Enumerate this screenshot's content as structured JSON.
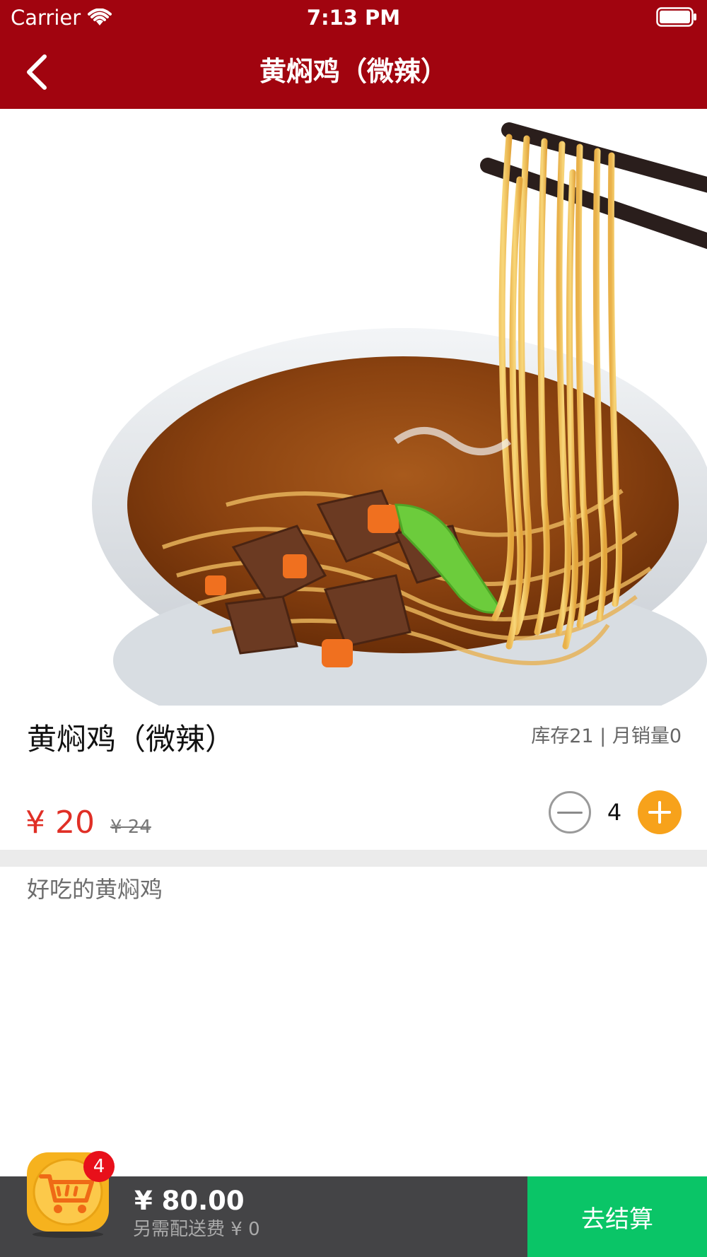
{
  "status_bar": {
    "carrier": "Carrier",
    "time": "7:13 PM"
  },
  "nav": {
    "title": "黄焖鸡（微辣）"
  },
  "product": {
    "name": "黄焖鸡（微辣）",
    "stock_sales": "库存21 | 月销量0",
    "price": "¥ 20",
    "original_price": "¥ 24",
    "quantity": "4",
    "description": "好吃的黄焖鸡"
  },
  "cart": {
    "badge_count": "4",
    "total": "¥ 80.00",
    "delivery_fee": "另需配送费 ¥ 0",
    "checkout_label": "去结算"
  },
  "colors": {
    "nav_background": "#a1040f",
    "price_red": "#e02f26",
    "plus_orange": "#f7a21b",
    "checkout_green": "#0ac567",
    "bottom_bar": "#444446"
  },
  "icons": [
    "wifi-icon",
    "battery-icon",
    "back-arrow-icon",
    "minus-icon",
    "plus-icon",
    "shopping-cart-icon"
  ]
}
